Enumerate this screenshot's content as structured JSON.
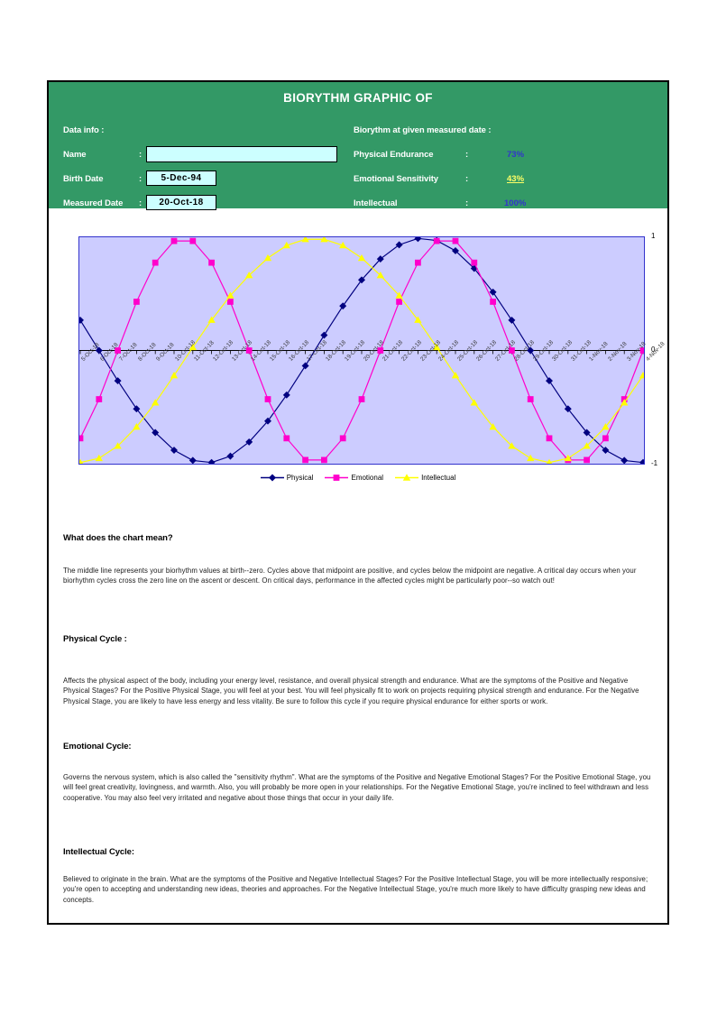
{
  "header": {
    "title": "BIORYTHM GRAPHIC OF",
    "data_info_label": "Data info :",
    "result_label": "Biorythm at given measured date :",
    "name_label": "Name",
    "birth_label": "Birth Date",
    "measured_label": "Measured Date",
    "colon": ":",
    "name_value": "",
    "name_placeholder": "",
    "birth_value": "5-Dec-94",
    "measured_value": "20-Oct-18",
    "physical_label": "Physical Endurance",
    "emotional_label": "Emotional Sensitivity",
    "intellectual_label": "Intellectual",
    "physical_value": "73%",
    "emotional_value": "43%",
    "intellectual_value": "100%",
    "colors": {
      "band": "#339966",
      "field_bg": "#ccffff",
      "value_blue": "#3333cc",
      "value_yellow": "#ffff66"
    }
  },
  "legend": [
    {
      "label": "Physical",
      "color": "#000080",
      "marker": "diamond"
    },
    {
      "label": "Emotional",
      "color": "#ff00cc",
      "marker": "square"
    },
    {
      "label": "Intellectual",
      "color": "#ffff00",
      "marker": "triangle"
    }
  ],
  "chart_data": {
    "type": "line",
    "title": "",
    "xlabel": "",
    "ylabel": "",
    "ylim": [
      -1,
      1
    ],
    "yticks": [
      "1",
      "0",
      "-1"
    ],
    "grid": false,
    "legend_position": "bottom",
    "plot_bgcolor": "#ccccff",
    "plot_bordercolor": "#3333cc",
    "zero_line": true,
    "categories": [
      "5-Oct-18",
      "6-Oct-18",
      "7-Oct-18",
      "8-Oct-18",
      "9-Oct-18",
      "10-Oct-18",
      "11-Oct-18",
      "12-Oct-18",
      "13-Oct-18",
      "14-Oct-18",
      "15-Oct-18",
      "16-Oct-18",
      "17-Oct-18",
      "18-Oct-18",
      "19-Oct-18",
      "20-Oct-18",
      "21-Oct-18",
      "22-Oct-18",
      "23-Oct-18",
      "24-Oct-18",
      "25-Oct-18",
      "26-Oct-18",
      "27-Oct-18",
      "28-Oct-18",
      "29-Oct-18",
      "30-Oct-18",
      "31-Oct-18",
      "1-Nov-18",
      "2-Nov-18",
      "3-Nov-18",
      "4-Nov-18"
    ],
    "series": [
      {
        "name": "Physical",
        "color": "#000080",
        "marker": "diamond",
        "values": [
          0.2698,
          -0.0,
          -0.2698,
          -0.5196,
          -0.7308,
          -0.8879,
          -0.9791,
          -0.9972,
          -0.9409,
          -0.8146,
          -0.6282,
          -0.3961,
          -0.1362,
          0.1362,
          0.3961,
          0.6282,
          0.8146,
          0.9409,
          0.9972,
          0.9791,
          0.8879,
          0.7308,
          0.5196,
          0.2698,
          0.0,
          -0.2698,
          -0.5196,
          -0.7308,
          -0.8879,
          -0.9791,
          -0.9972
        ]
      },
      {
        "name": "Emotional",
        "color": "#ff00cc",
        "marker": "square",
        "values": [
          -0.7818,
          -0.4339,
          -0.0,
          0.4339,
          0.7818,
          0.9749,
          0.9749,
          0.7818,
          0.4339,
          0.0,
          -0.4339,
          -0.7818,
          -0.9749,
          -0.9749,
          -0.7818,
          -0.4339,
          -0.0,
          0.4339,
          0.7818,
          0.9749,
          0.9749,
          0.7818,
          0.4339,
          0.0,
          -0.4339,
          -0.7818,
          -0.9749,
          -0.9749,
          -0.7818,
          -0.4339,
          0.0
        ]
      },
      {
        "name": "Intellectual",
        "color": "#ffff00",
        "marker": "triangle",
        "values": [
          -0.998,
          -0.9595,
          -0.8502,
          -0.6802,
          -0.4647,
          -0.2225,
          0.0285,
          0.2714,
          0.4891,
          0.6691,
          0.823,
          0.935,
          0.9898,
          0.9898,
          0.935,
          0.823,
          0.6691,
          0.4891,
          0.2714,
          0.0285,
          -0.2225,
          -0.4647,
          -0.6802,
          -0.8502,
          -0.9595,
          -0.998,
          -0.9595,
          -0.8502,
          -0.6802,
          -0.4647,
          -0.2225
        ]
      }
    ]
  },
  "sections": [
    {
      "heading": "What does the chart mean?",
      "body": "The middle line represents your biorhythm values at birth--zero. Cycles above that midpoint are positive, and cycles below the midpoint are negative. A critical day occurs when your biorhythm cycles cross the zero line on the ascent or descent. On critical days, performance in the affected cycles might be particularly poor--so watch out!"
    },
    {
      "heading": "Physical Cycle :",
      "body": "Affects the physical aspect of the body, including your energy level, resistance, and overall physical strength and endurance. What are the symptoms of the Positive and Negative Physical Stages? For the Positive Physical Stage, you will feel at your best. You will feel physically fit to work on projects requiring physical strength and endurance. For the Negative Physical Stage, you are likely to have less energy and less vitality. Be sure to follow this cycle if you require physical endurance for either sports or work."
    },
    {
      "heading": "Emotional Cycle:",
      "body": "Governs the nervous system, which is also called the \"sensitivity rhythm\". What are the symptoms of the Positive and Negative Emotional Stages? For the Positive Emotional Stage, you will feel great creativity, lovingness, and warmth. Also, you will probably be more open in your relationships. For the Negative Emotional Stage, you're inclined to feel withdrawn and less cooperative. You may also feel very irritated and negative about those things that occur in your daily life."
    },
    {
      "heading": "Intellectual Cycle:",
      "body": "Believed to originate in the brain. What are the symptoms of the Positive and Negative Intellectual Stages? For the Positive Intellectual Stage, you will be more intellectually responsive; you're open to accepting and understanding new ideas, theories and approaches. For the Negative Intellectual Stage, you're much more likely to have difficulty grasping new ideas and concepts."
    }
  ]
}
